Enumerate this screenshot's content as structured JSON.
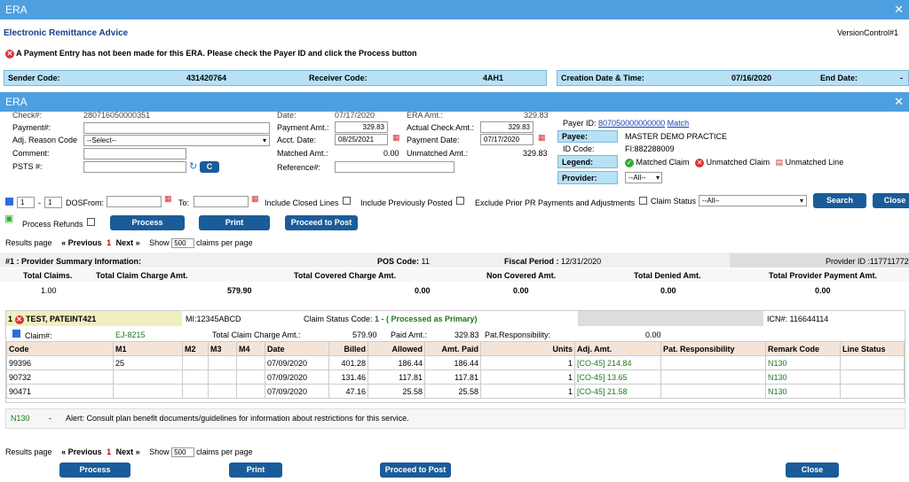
{
  "outer": {
    "title": "ERA",
    "subtitle": "Electronic Remittance Advice",
    "version": "VersionControl#1",
    "alert": "A Payment Entry has not been made for this ERA. Please check the Payer ID and click the Process button",
    "sender_label": "Sender Code:",
    "sender_value": "431420764",
    "receiver_label": "Receiver Code:",
    "receiver_value": "4AH1",
    "creation_label": "Creation Date & Time:",
    "creation_value": "07/16/2020",
    "end_label": "End Date:",
    "end_value": "-"
  },
  "inner": {
    "title": "ERA",
    "check_label": "Check#:",
    "check_value": "280716050000351",
    "date_label": "Date:",
    "date_value": "07/17/2020",
    "era_label": "ERA Amt.:",
    "era_value": "329.83",
    "payment_label": "Payment#:",
    "payment_amt_label": "Payment Amt.:",
    "payment_amt_value": "329.83",
    "actual_check_label": "Actual Check Amt.:",
    "actual_check_value": "329.83",
    "adj_label": "Adj. Reason Code",
    "adj_value": "--Select--",
    "acct_date_label": "Acct. Date:",
    "acct_date_value": "08/25/2021",
    "payment_date_label": "Payment Date:",
    "payment_date_value": "07/17/2020",
    "comment_label": "Comment:",
    "matched_label": "Matched Amt.:",
    "matched_value": "0.00",
    "unmatched_label": "Unmatched Amt.:",
    "unmatched_value": "329.83",
    "psts_label": "PSTS #:",
    "c_button": "C",
    "reference_label": "Reference#:",
    "payer_id_label": "Payer ID:",
    "payer_id_value": "807050000000000",
    "match_link": "Match",
    "payee_label": "Payee:",
    "payee_value": "MASTER DEMO PRACTICE",
    "id_code_label": "ID Code:",
    "id_code_value": "FI:882288009",
    "legend_label": "Legend:",
    "legend_matched": "Matched Claim",
    "legend_unmatched": "Unmatched Claim",
    "legend_unmatched_line": "Unmatched Line",
    "provider_label": "Provider:",
    "provider_value": "--All--"
  },
  "filters": {
    "from_value": "1",
    "to_value": "1",
    "dos_from": "DOSFrom:",
    "to_label": "To:",
    "include_closed": "Include Closed Lines",
    "include_prev": "Include Previously Posted",
    "exclude_prior": "Exclude Prior PR Payments and Adjustments",
    "claim_status": "Claim Status",
    "claim_status_value": "--All--",
    "search": "Search",
    "close": "Close",
    "process_refunds": "Process Refunds",
    "process": "Process",
    "print": "Print",
    "proceed": "Proceed to Post"
  },
  "paging": {
    "results_label": "Results page",
    "previous": "« Previous",
    "page": "1",
    "next": "Next »",
    "show": "Show",
    "per_page": "500",
    "suffix": "claims per page"
  },
  "summary": {
    "title": "#1 : Provider Summary Information:",
    "pos_label": "POS Code:",
    "pos_value": "11",
    "fiscal_label": "Fiscal Period :",
    "fiscal_value": "12/31/2020",
    "provider_id": "Provider ID :117711772",
    "headers": [
      "Total Claims.",
      "Total Claim Charge Amt.",
      "Total Covered Charge Amt.",
      "Non Covered Amt.",
      "Total Denied Amt.",
      "Total Provider Payment Amt."
    ],
    "values": [
      "1.00",
      "579.90",
      "0.00",
      "0.00",
      "0.00",
      "0.00"
    ]
  },
  "claim": {
    "number": "1",
    "patient": "TEST, PATEINT421",
    "mi": "MI:12345ABCD",
    "status_label": "Claim Status Code:",
    "status_value": "1 - ( Processed as Primary)",
    "icn": "ICN#: 116644114",
    "claim_label": "Claim#:",
    "claim_value": "EJ-8215",
    "charge_label": "Total Claim Charge Amt.:",
    "charge_value": "579.90",
    "paid_label": "Paid Amt.:",
    "paid_value": "329.83",
    "pat_resp_label": "Pat.Responsibility:",
    "pat_resp_value": "0.00",
    "columns": [
      "Code",
      "M1",
      "M2",
      "M3",
      "M4",
      "Date",
      "Billed",
      "Allowed",
      "Amt. Paid",
      "Units",
      "Adj. Amt.",
      "Pat. Responsibility",
      "Remark Code",
      "Line Status"
    ],
    "rows": [
      [
        "99396",
        "25",
        "",
        "",
        "",
        "07/09/2020",
        "401.28",
        "186.44",
        "186.44",
        "1",
        "[CO-45] 214.84",
        "",
        "N130",
        ""
      ],
      [
        "90732",
        "",
        "",
        "",
        "",
        "07/09/2020",
        "131.46",
        "117.81",
        "117.81",
        "1",
        "[CO-45] 13.65",
        "",
        "N130",
        ""
      ],
      [
        "90471",
        "",
        "",
        "",
        "",
        "07/09/2020",
        "47.16",
        "25.58",
        "25.58",
        "1",
        "[CO-45] 21.58",
        "",
        "N130",
        ""
      ]
    ],
    "remark_code": "N130",
    "remark_dash": "-",
    "remark_text": "Alert: Consult plan benefit documents/guidelines for information about restrictions for this service."
  },
  "footer": {
    "process": "Process",
    "print": "Print",
    "proceed": "Proceed to Post",
    "close": "Close"
  }
}
